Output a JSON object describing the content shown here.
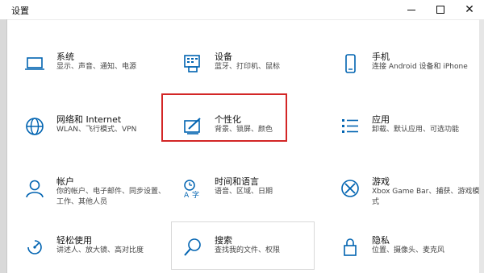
{
  "window": {
    "title": "设置"
  },
  "accent_color": "#0063b1",
  "highlight_color": "#d32626",
  "items": [
    {
      "key": "system",
      "label": "系统",
      "desc1": "显示、声音、通知、电源",
      "desc2": "",
      "icon": "laptop-icon"
    },
    {
      "key": "devices",
      "label": "设备",
      "desc1": "蓝牙、打印机、鼠标",
      "desc2": "",
      "icon": "keyboard-printer-icon"
    },
    {
      "key": "phone",
      "label": "手机",
      "desc1": "连接 Android 设备和 iPhone",
      "desc2": "",
      "icon": "phone-icon"
    },
    {
      "key": "network",
      "label": "网络和 Internet",
      "desc1": "WLAN、飞行模式、VPN",
      "desc2": "",
      "icon": "globe-icon"
    },
    {
      "key": "personalization",
      "label": "个性化",
      "desc1": "背景、锁屏、颜色",
      "desc2": "",
      "icon": "pen-tablet-icon"
    },
    {
      "key": "apps",
      "label": "应用",
      "desc1": "卸载、默认应用、可选功能",
      "desc2": "",
      "icon": "apps-list-icon"
    },
    {
      "key": "accounts",
      "label": "帐户",
      "desc1": "你的帐户、电子邮件、同步设置、",
      "desc2": "工作、其他人员",
      "icon": "person-icon"
    },
    {
      "key": "time",
      "label": "时间和语言",
      "desc1": "语音、区域、日期",
      "desc2": "",
      "icon": "time-language-icon"
    },
    {
      "key": "gaming",
      "label": "游戏",
      "desc1": "Xbox Game Bar、捕获、游戏模",
      "desc2": "式",
      "icon": "xbox-icon"
    },
    {
      "key": "ease",
      "label": "轻松使用",
      "desc1": "讲述人、放大镜、高对比度",
      "desc2": "",
      "icon": "ease-of-access-icon"
    },
    {
      "key": "search",
      "label": "搜索",
      "desc1": "查找我的文件、权限",
      "desc2": "",
      "icon": "search-icon"
    },
    {
      "key": "privacy",
      "label": "隐私",
      "desc1": "位置、摄像头、麦克风",
      "desc2": "",
      "icon": "lock-icon"
    }
  ]
}
